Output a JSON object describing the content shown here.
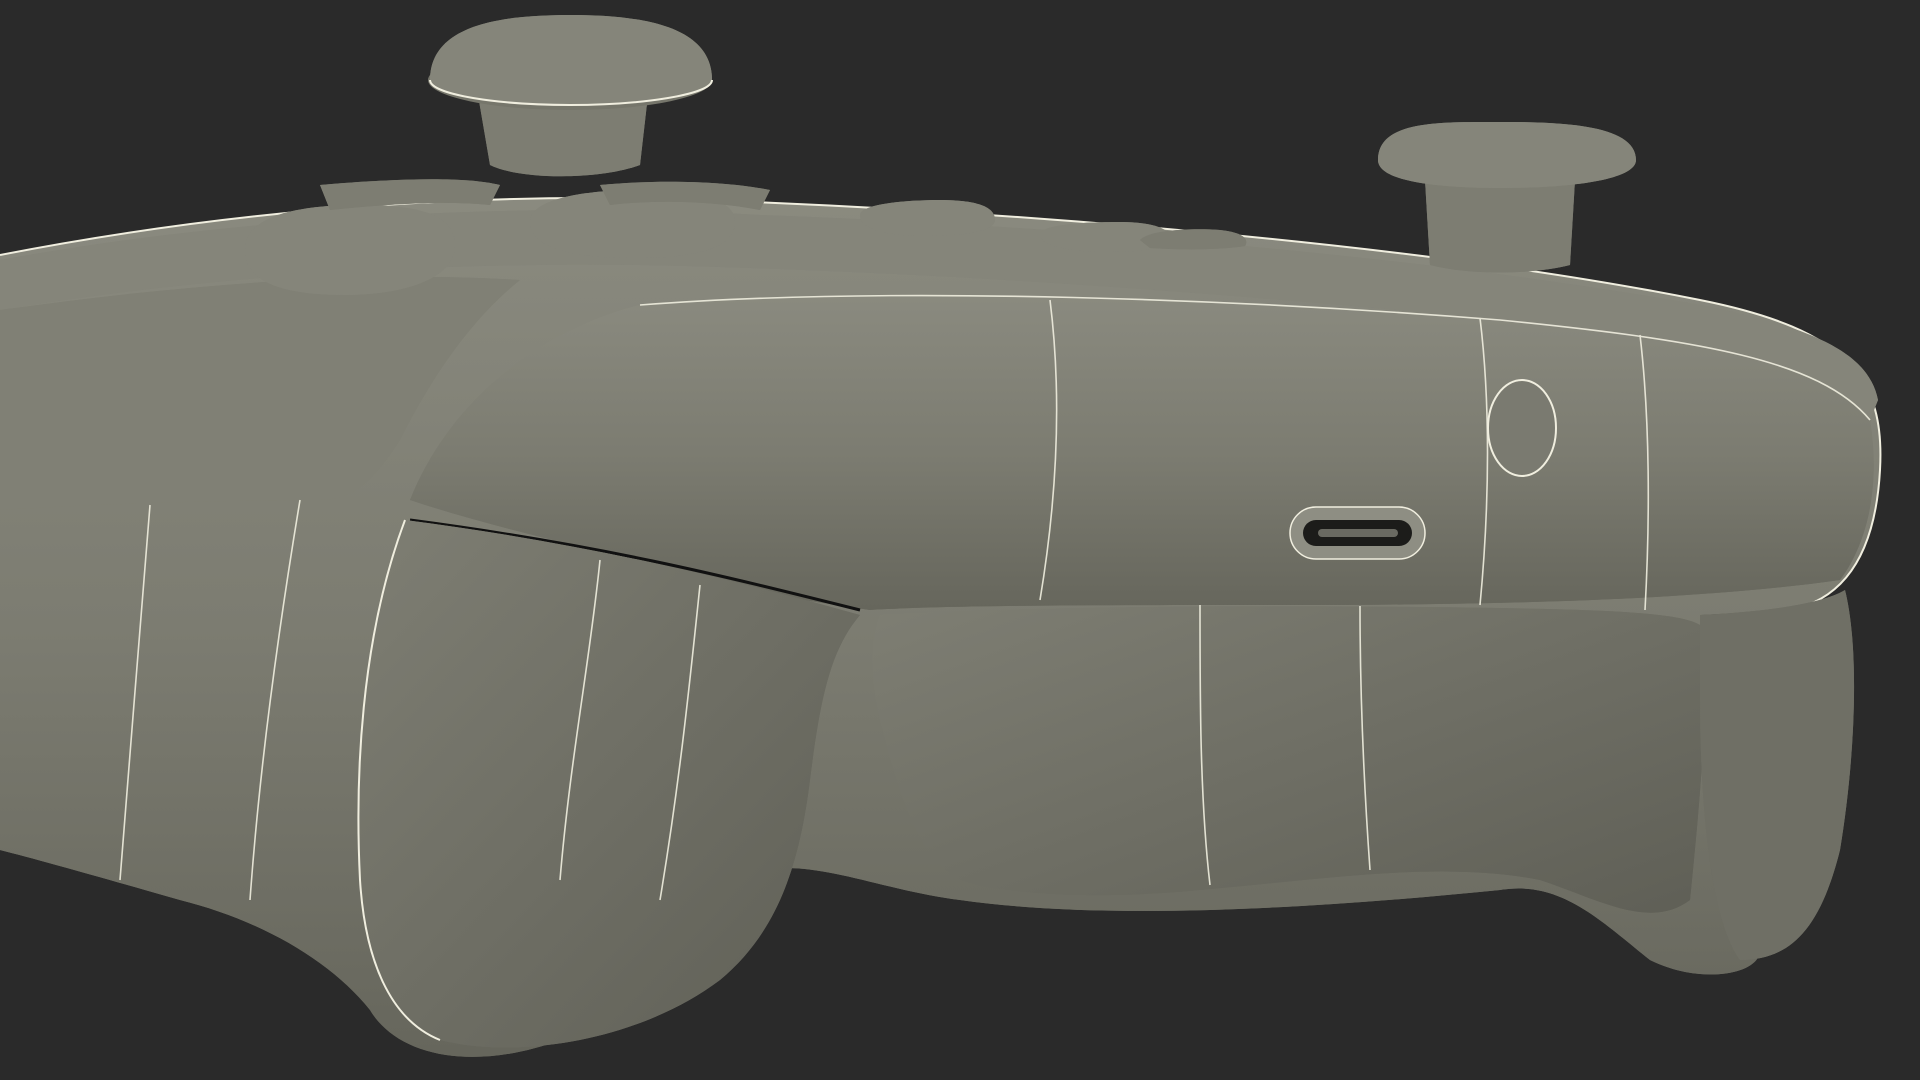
{
  "scene": {
    "subject": "controller-wireframe-render",
    "background_color": "#2a2a2a",
    "shell_color": "#7b7b70",
    "shell_shadow_color": "#55554c",
    "wire_color": "#e8e6d6",
    "slot_color": "#1a1a1a"
  }
}
